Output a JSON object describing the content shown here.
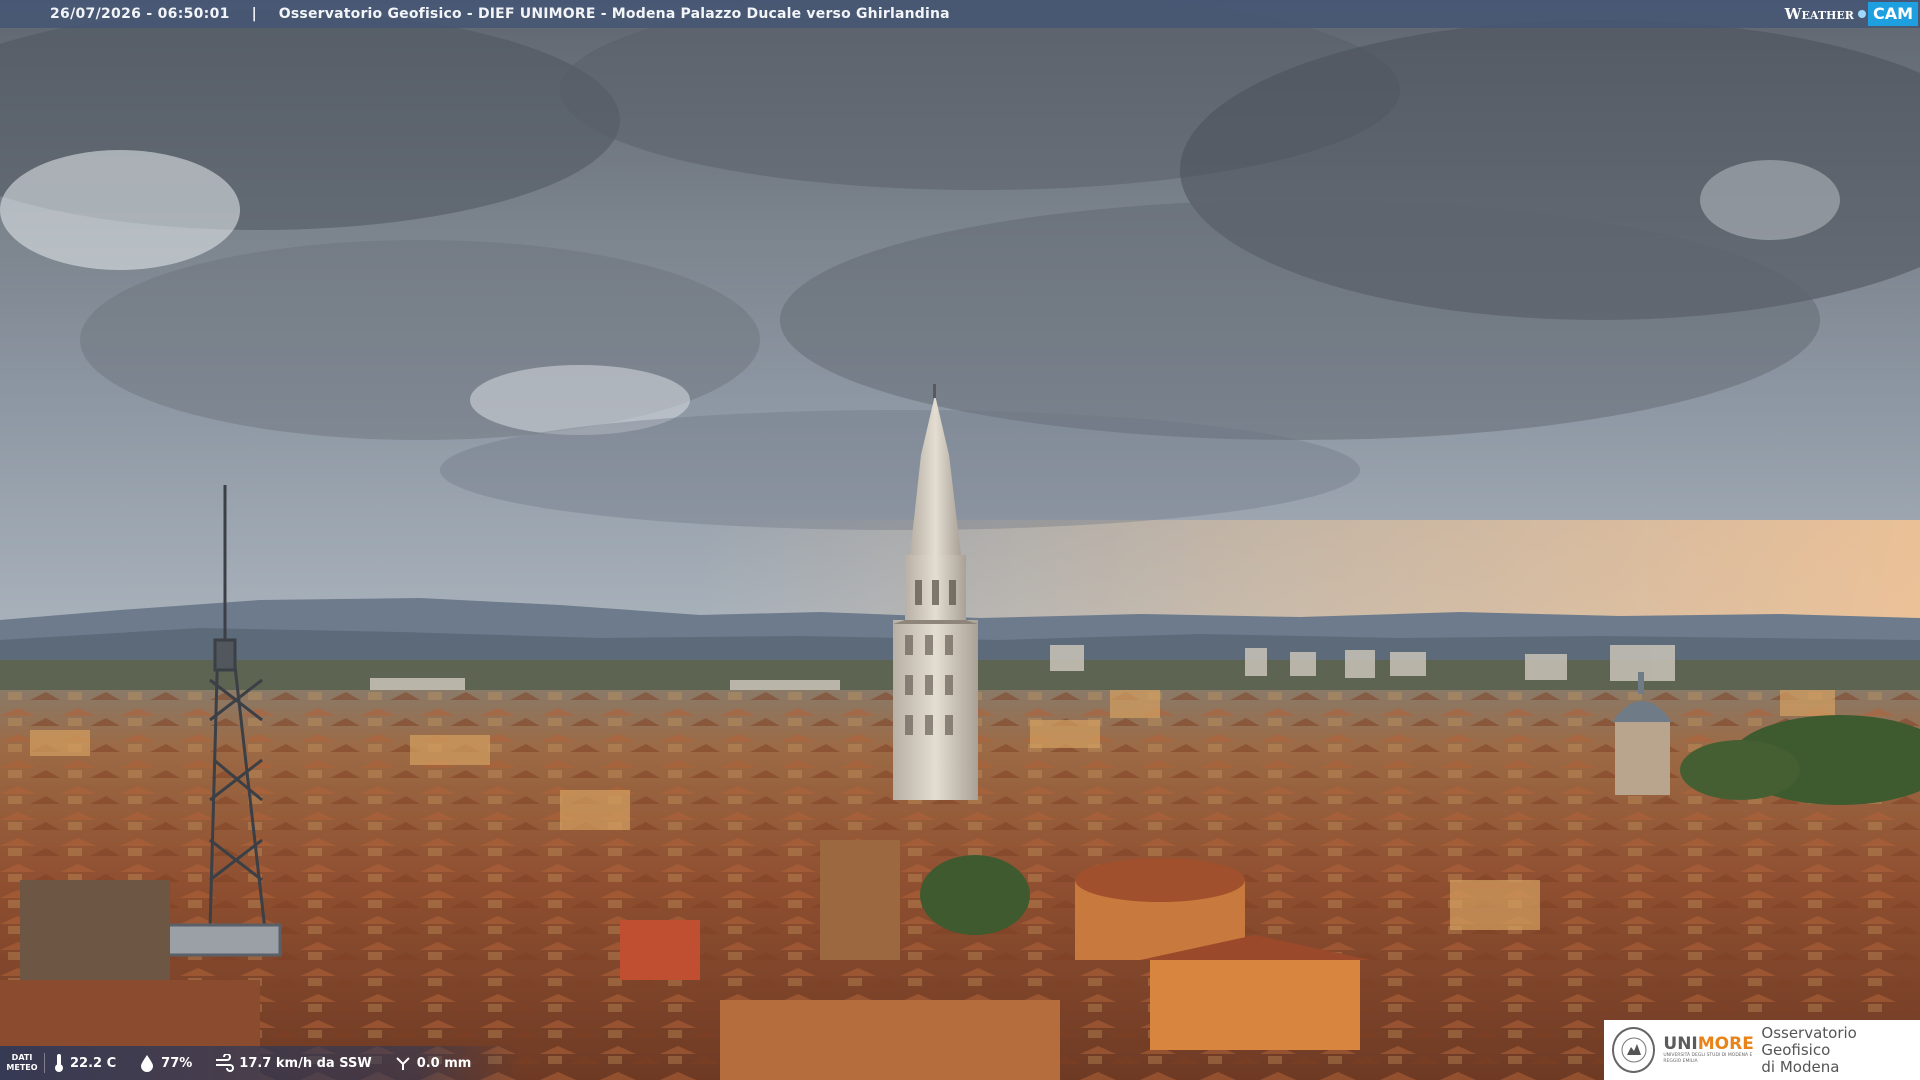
{
  "overlay": {
    "timestamp": "26/07/2026 - 06:50:01",
    "separator": "|",
    "location": "Osservatorio Geofisico - DIEF UNIMORE - Modena Palazzo Ducale verso Ghirlandina",
    "brand_word": "Weather",
    "brand_cam": "CAM"
  },
  "meteo": {
    "label_line1": "DATI",
    "label_line2": "METEO",
    "temperature": "22.2 C",
    "humidity": "77%",
    "wind": "17.7 km/h da SSW",
    "rain": "0.0 mm"
  },
  "logo": {
    "uni_prefix": "UNI",
    "uni_suffix": "MORE",
    "uni_sub": "UNIVERSITÀ DEGLI STUDI DI MODENA E REGGIO EMILIA",
    "obs_line1": "Osservatorio Geofisico",
    "obs_line2": "di Modena"
  },
  "colors": {
    "bar_bg": "#465674",
    "brand_blue": "#1d9fe0",
    "logo_orange": "#e8841a",
    "roof_terracotta": "#a5532e"
  },
  "icons": [
    "thermometer-icon",
    "humidity-drop-icon",
    "wind-icon",
    "rain-gauge-icon",
    "unimore-seal-icon"
  ]
}
